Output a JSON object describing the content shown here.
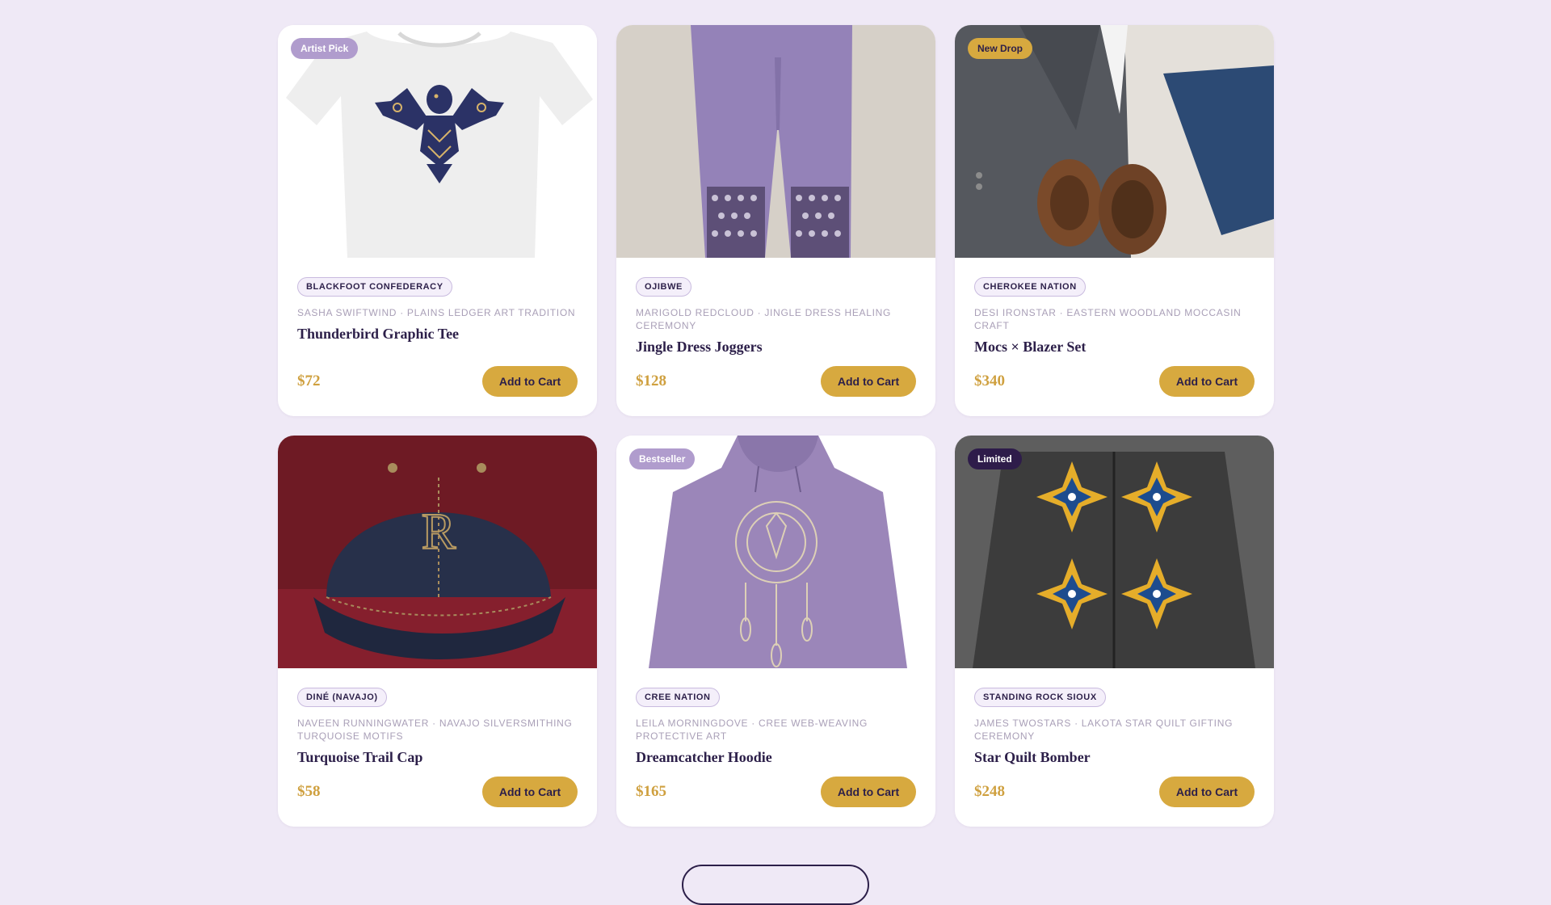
{
  "products": [
    {
      "ribbon": "Artist Pick",
      "nation": "Blackfoot Confederacy",
      "meta": "Sasha Swiftwind · Plains Ledger Art Tradition",
      "name": "Thunderbird Graphic Tee",
      "price": "$72",
      "cta": "Add to Cart"
    },
    {
      "ribbon": "",
      "nation": "Ojibwe",
      "meta": "Marigold Redcloud · Jingle Dress Healing Ceremony",
      "name": "Jingle Dress Joggers",
      "price": "$128",
      "cta": "Add to Cart"
    },
    {
      "ribbon": "New Drop",
      "nation": "Cherokee Nation",
      "meta": "Desi Ironstar · Eastern Woodland Moccasin Craft",
      "name": "Mocs × Blazer Set",
      "price": "$340",
      "cta": "Add to Cart"
    },
    {
      "ribbon": "",
      "nation": "Diné (Navajo)",
      "meta": "Naveen Runningwater · Navajo Silversmithing Turquoise Motifs",
      "name": "Turquoise Trail Cap",
      "price": "$58",
      "cta": "Add to Cart"
    },
    {
      "ribbon": "Bestseller",
      "nation": "Cree Nation",
      "meta": "Leila Morningdove · Cree Web-Weaving Protective Art",
      "name": "Dreamcatcher Hoodie",
      "price": "$165",
      "cta": "Add to Cart"
    },
    {
      "ribbon": "Limited",
      "nation": "Standing Rock Sioux",
      "meta": "James Twostars · Lakota Star Quilt Gifting Ceremony",
      "name": "Star Quilt Bomber",
      "price": "$248",
      "cta": "Add to Cart"
    }
  ],
  "colors": {
    "page_bg": "#efe9f6",
    "accent_gold": "#d7a93f",
    "ink": "#2c1f49",
    "lavender": "#b09ccd"
  }
}
